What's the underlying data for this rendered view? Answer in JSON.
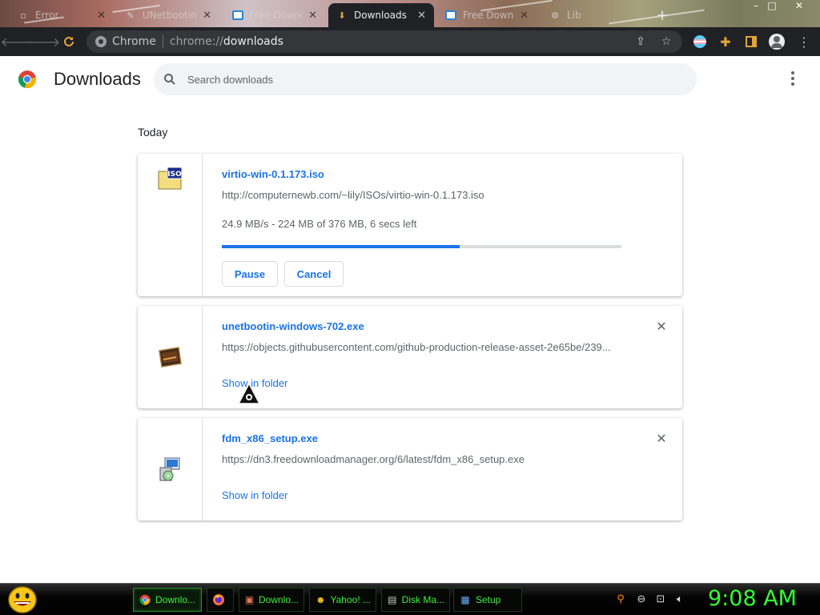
{
  "browser": {
    "tabs": [
      {
        "title": "Error",
        "icon": "page-icon",
        "active": false
      },
      {
        "title": "UNetbootin",
        "icon": "unetbootin-icon",
        "active": false
      },
      {
        "title": "Free Downlo",
        "icon": "fdm-icon",
        "active": false
      },
      {
        "title": "Downloads",
        "icon": "download-icon",
        "active": true
      },
      {
        "title": "Free Downl",
        "icon": "fdm-icon",
        "active": false
      },
      {
        "title": "Lib",
        "icon": "settings-icon",
        "active": false
      }
    ],
    "new_tab_glyph": "+",
    "window_controls": {
      "minimize": "–",
      "maximize": "□",
      "close": "✕"
    },
    "omnibox": {
      "site_label": "Chrome",
      "url_scheme": "chrome://",
      "url_host": "downloads"
    }
  },
  "page": {
    "title": "Downloads",
    "search": {
      "placeholder": "Search downloads"
    },
    "date_group": "Today",
    "downloads": [
      {
        "file_name": "virtio-win-0.1.173.iso",
        "url": "http://computernewb.com/~lily/ISOs/virtio-win-0.1.173.iso",
        "status": "24.9 MB/s - 224 MB of 376 MB, 6 secs left",
        "progress_fraction": 0.5957,
        "buttons": {
          "pause": "Pause",
          "cancel": "Cancel"
        },
        "icon": "iso-file-icon",
        "icon_label": "ISO"
      },
      {
        "file_name": "unetbootin-windows-702.exe",
        "url": "https://objects.githubusercontent.com/github-production-release-asset-2e65be/239...",
        "link": "Show in folder",
        "icon": "unetbootin-exe-icon"
      },
      {
        "file_name": "fdm_x86_setup.exe",
        "url": "https://dn3.freedownloadmanager.org/6/latest/fdm_x86_setup.exe",
        "link": "Show in folder",
        "icon": "installer-icon"
      }
    ]
  },
  "taskbar": {
    "buttons": [
      {
        "label": "Downlo...",
        "icon": "chrome-icon",
        "active": true
      },
      {
        "label": "",
        "icon": "firefox-icon",
        "active": false
      },
      {
        "label": "Downlo...",
        "icon": "download-icon",
        "active": false
      },
      {
        "label": "Yahoo! ...",
        "icon": "yahoo-smiley-icon",
        "active": false
      },
      {
        "label": "Disk Ma...",
        "icon": "disk-icon",
        "active": false
      },
      {
        "label": "Setup",
        "icon": "installer-icon",
        "active": false
      }
    ],
    "clock": "9:08 AM"
  },
  "colors": {
    "accent": "#1a73e8",
    "toolbar_bg": "#202124",
    "clock_green": "#32ff32"
  }
}
